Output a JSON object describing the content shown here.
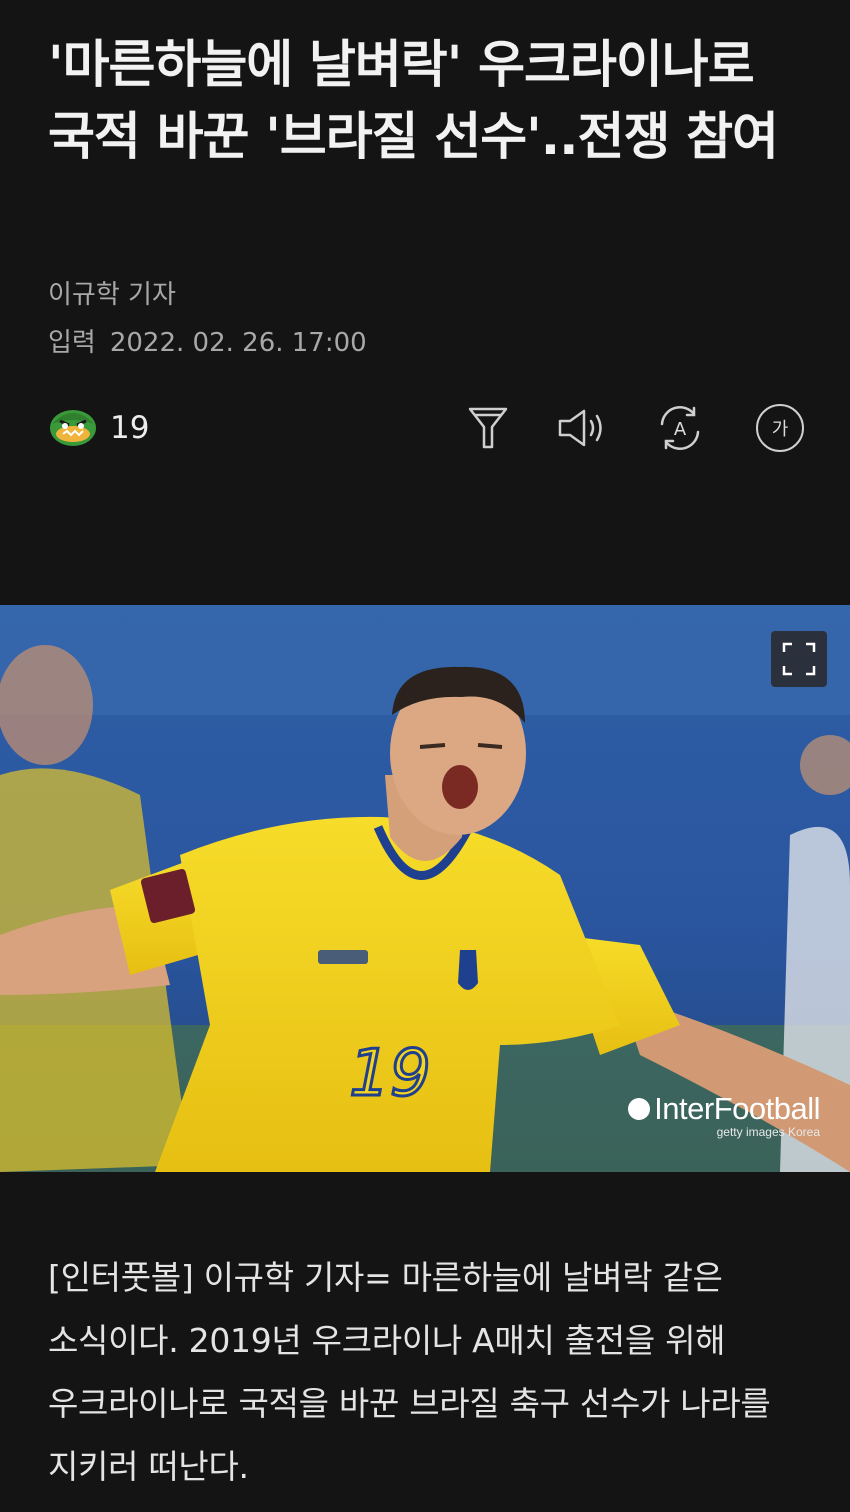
{
  "article": {
    "headline": "'마른하늘에 날벼락' 우크라이나로 국적 바꾼 '브라질 선수'..전쟁 참여",
    "byline": "이규학 기자",
    "date_label": "입력",
    "date_value": "2022. 02. 26. 17:00",
    "body": "[인터풋볼] 이규학 기자= 마른하늘에 날벼락 같은 소식이다. 2019년 우크라이나 A매치 출전을 위해 우크라이나로 국적을 바꾼 브라질 축구 선수가 나라를 지키러 떠난다."
  },
  "toolbar": {
    "reaction_icon": "angry-face-icon",
    "reaction_count": "19",
    "icons": [
      "filter-icon",
      "speaker-icon",
      "translate-icon",
      "font-size-icon"
    ],
    "font_glyph": "가",
    "translate_glyph": "A"
  },
  "photo": {
    "jersey_number": "19",
    "watermark_main": "InterFootball",
    "watermark_sub": "getty images Korea",
    "expand_icon": "expand-icon"
  },
  "colors": {
    "background": "#141414",
    "jersey_yellow": "#f2d21e",
    "jersey_blue": "#1f3f8f"
  }
}
